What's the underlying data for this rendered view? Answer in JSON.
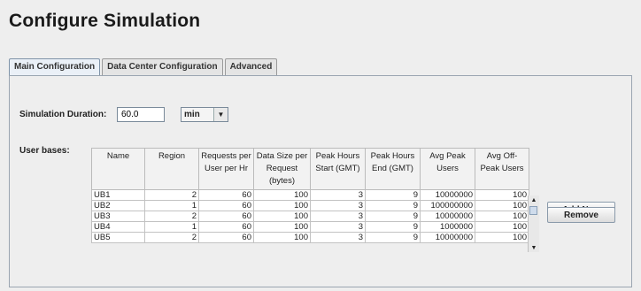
{
  "page_title": "Configure Simulation",
  "tabs": [
    {
      "label": "Main Configuration",
      "active": true
    },
    {
      "label": "Data Center Configuration",
      "active": false
    },
    {
      "label": "Advanced",
      "active": false
    }
  ],
  "duration": {
    "label": "Simulation Duration:",
    "value": "60.0",
    "unit": "min"
  },
  "user_bases": {
    "label": "User bases:",
    "columns": [
      "Name",
      "Region",
      "Requests per User per Hr",
      "Data Size per Request (bytes)",
      "Peak Hours Start (GMT)",
      "Peak Hours End (GMT)",
      "Avg Peak Users",
      "Avg Off-Peak Users"
    ],
    "rows": [
      [
        "UB1",
        "2",
        "60",
        "100",
        "3",
        "9",
        "10000000",
        "100"
      ],
      [
        "UB2",
        "1",
        "60",
        "100",
        "3",
        "9",
        "100000000",
        "100"
      ],
      [
        "UB3",
        "2",
        "60",
        "100",
        "3",
        "9",
        "10000000",
        "100"
      ],
      [
        "UB4",
        "1",
        "60",
        "100",
        "3",
        "9",
        "1000000",
        "100"
      ],
      [
        "UB5",
        "2",
        "60",
        "100",
        "3",
        "9",
        "10000000",
        "100"
      ]
    ]
  },
  "buttons": {
    "add_new": "Add New",
    "remove": "Remove"
  },
  "icons": {
    "scroll_up": "▲",
    "scroll_down": "▼",
    "dropdown": "▼"
  }
}
